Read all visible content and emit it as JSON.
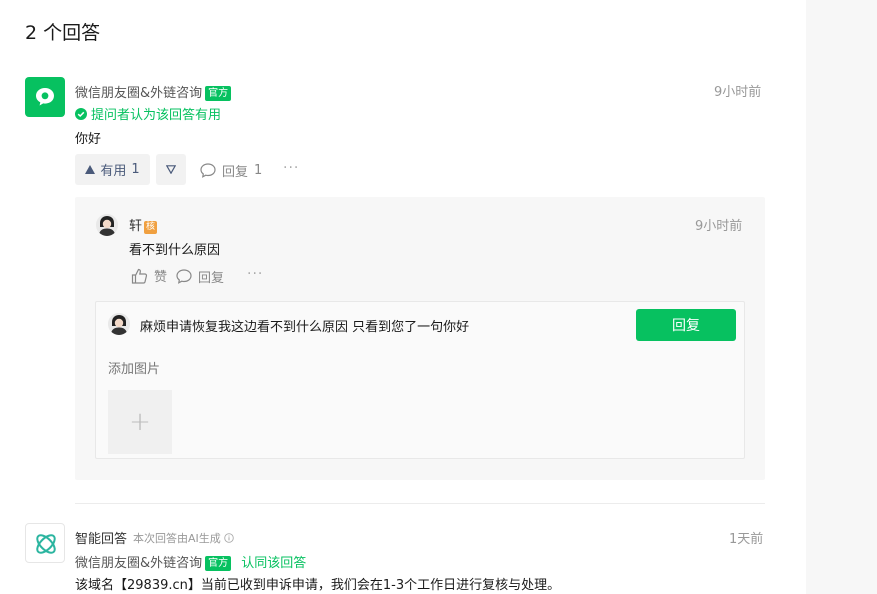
{
  "header": {
    "answers_count": "2 个回答"
  },
  "answers": [
    {
      "author": "微信朋友圈&外链咨询",
      "badge": "官方",
      "time": "9小时前",
      "accepted_text": "提问者认为该回答有用",
      "content": "你好",
      "useful_label": "有用",
      "useful_count": "1",
      "reply_label": "回复",
      "reply_count": "1",
      "more": "···"
    },
    {
      "author_title": "智能回答",
      "ai_note": "本次回答由AI生成",
      "time": "1天前",
      "author": "微信朋友圈&外链咨询",
      "badge": "官方",
      "agree_text": "认同该回答",
      "content": "该域名【29839.cn】当前已收到申诉申请，我们会在1-3个工作日进行复核与处理。"
    }
  ],
  "comment": {
    "author": "轩",
    "level_badge": "核",
    "time": "9小时前",
    "content": "看不到什么原因",
    "like_label": "赞",
    "reply_label": "回复",
    "more": "···"
  },
  "reply_form": {
    "input_value": "麻烦申请恢复我这边看不到什么原因 只看到您了一句你好",
    "submit_label": "回复",
    "add_image_label": "添加图片",
    "add_image_symbol": "+"
  },
  "colors": {
    "brand_green": "#07c160",
    "badge_orange": "#f0a040"
  }
}
